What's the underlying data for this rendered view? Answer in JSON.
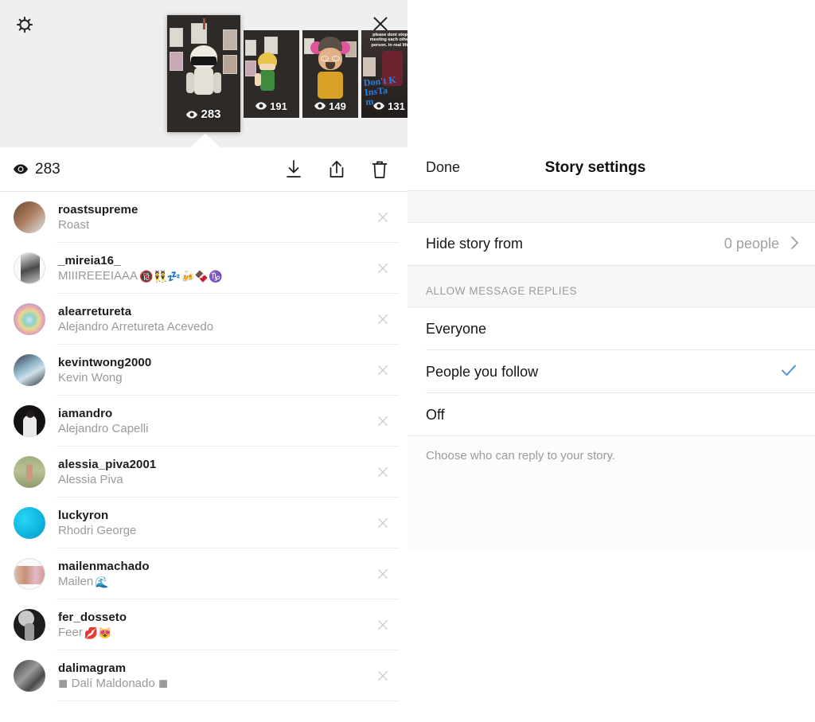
{
  "left": {
    "gear_icon": "gear-icon",
    "close_icon": "close-icon",
    "stories": [
      {
        "views": "283",
        "selected": true,
        "caption": ""
      },
      {
        "views": "191",
        "selected": false,
        "caption": ""
      },
      {
        "views": "149",
        "selected": false,
        "caption": ""
      },
      {
        "views": "131",
        "selected": false,
        "caption": "please dont stop meeting each other person. in real life"
      }
    ],
    "toolbar": {
      "view_count": "283",
      "eye_icon": "eye-icon",
      "download_icon": "download-icon",
      "share_icon": "share-icon",
      "delete_icon": "trash-icon"
    },
    "viewers": [
      {
        "username": "roastsupreme",
        "fullname": "Roast",
        "emoji": "",
        "avatar": "#8d6a52",
        "ring": false
      },
      {
        "username": "_mireia16_",
        "fullname": "MIIIREEEIAAA",
        "emoji": "🔞👯💤🍻🍫♑",
        "avatar": "#f0f0f0",
        "ring": true
      },
      {
        "username": "alearretureta",
        "fullname": "Alejandro Arretureta Acevedo",
        "emoji": "",
        "avatar": "#7fb3c9",
        "ring": false
      },
      {
        "username": "kevintwong2000",
        "fullname": "Kevin Wong",
        "emoji": "",
        "avatar": "#6f8da0",
        "ring": false
      },
      {
        "username": "iamandro",
        "fullname": "Alejandro Capelli",
        "emoji": "",
        "avatar": "#1a1a1a",
        "ring": false
      },
      {
        "username": "alessia_piva2001",
        "fullname": "Alessia Piva",
        "emoji": "",
        "avatar": "#9aa07a",
        "ring": false
      },
      {
        "username": "luckyron",
        "fullname": "Rhodri George",
        "emoji": "",
        "avatar": "#12bfe8",
        "ring": false
      },
      {
        "username": "mailenmachado",
        "fullname": "Mailen",
        "emoji": "🌊",
        "avatar": "#d8b9a8",
        "ring": true
      },
      {
        "username": "fer_dosseto",
        "fullname": "Feer",
        "emoji": "💋😻",
        "avatar": "#2b2b2b",
        "ring": false
      },
      {
        "username": "dalimagram",
        "fullname": "◼ Dalí Maldonado ◼",
        "emoji": "",
        "avatar": "#555555",
        "ring": false
      }
    ]
  },
  "settings": {
    "done_label": "Done",
    "title": "Story settings",
    "hide_story": {
      "label": "Hide story from",
      "value": "0 people",
      "chevron": "chevron-right-icon"
    },
    "section_label": "ALLOW MESSAGE REPLIES",
    "options": [
      {
        "label": "Everyone",
        "checked": false
      },
      {
        "label": "People you follow",
        "checked": true
      },
      {
        "label": "Off",
        "checked": false
      }
    ],
    "footer": "Choose who can reply to your story.",
    "accent_color": "#4a90d9",
    "check_icon": "check-icon"
  }
}
